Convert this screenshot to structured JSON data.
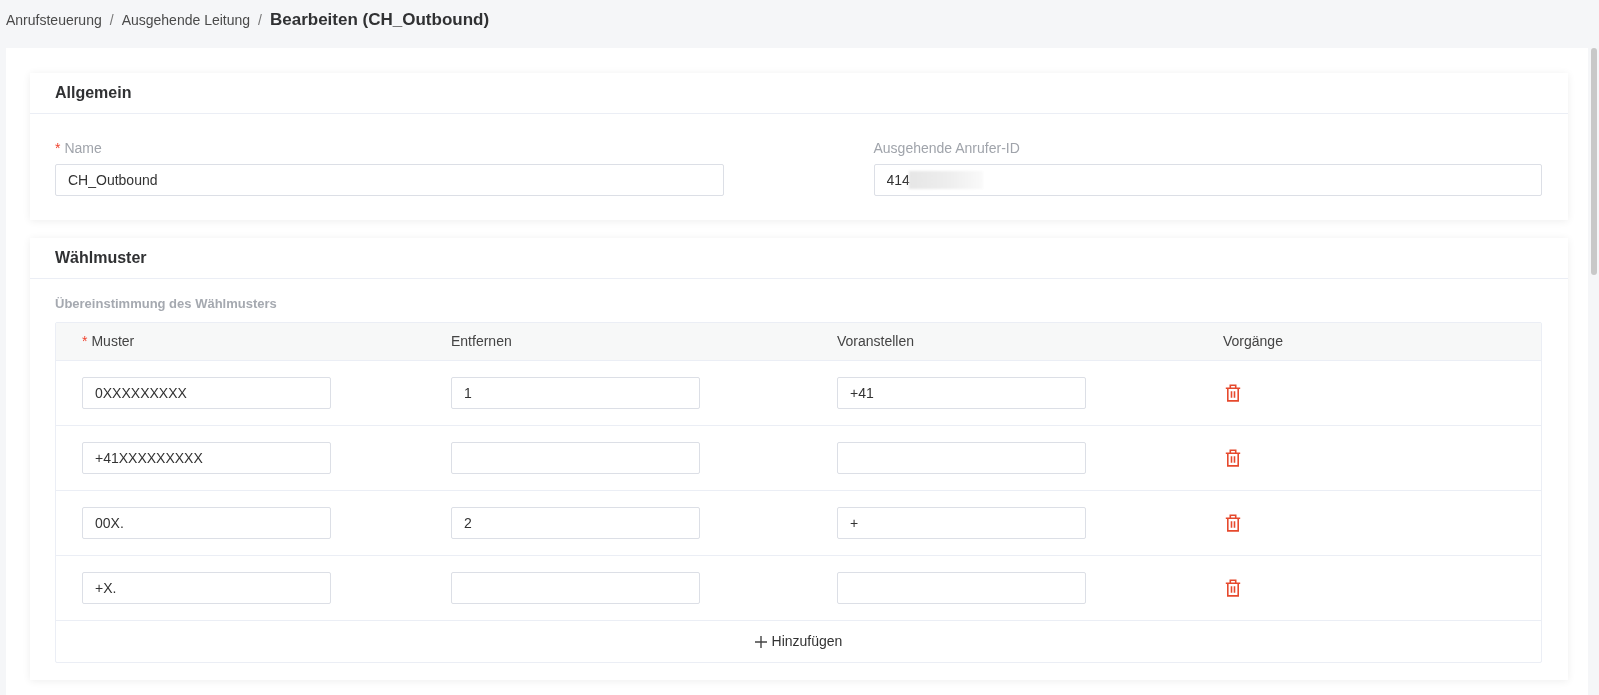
{
  "breadcrumb": {
    "items": [
      {
        "label": "Anrufsteuerung",
        "separator": "/"
      },
      {
        "label": "Ausgehende Leitung",
        "separator": "/"
      }
    ],
    "current": "Bearbeiten (CH_Outbound)"
  },
  "general": {
    "title": "Allgemein",
    "fields": [
      {
        "required_mark": "*",
        "label": "Name",
        "value": "CH_Outbound",
        "redacted": false
      },
      {
        "label": "Ausgehende Anrufer-ID",
        "value": "414",
        "redacted": true
      }
    ]
  },
  "dial_patterns": {
    "title": "Wählmuster",
    "subtitle": "Übereinstimmung des Wählmusters",
    "columns": [
      {
        "required_mark": "*",
        "label": "Muster"
      },
      {
        "label": "Entfernen"
      },
      {
        "label": "Voranstellen"
      },
      {
        "label": "Vorgänge"
      }
    ],
    "rows": [
      {
        "pattern": "0XXXXXXXXX",
        "strip": "1",
        "prepend": "+41"
      },
      {
        "pattern": "+41XXXXXXXXX"
      },
      {
        "pattern": "00X.",
        "strip": "2",
        "prepend": "+"
      },
      {
        "pattern": "+X."
      }
    ],
    "add_button": {
      "label": "Hinzufügen"
    }
  }
}
